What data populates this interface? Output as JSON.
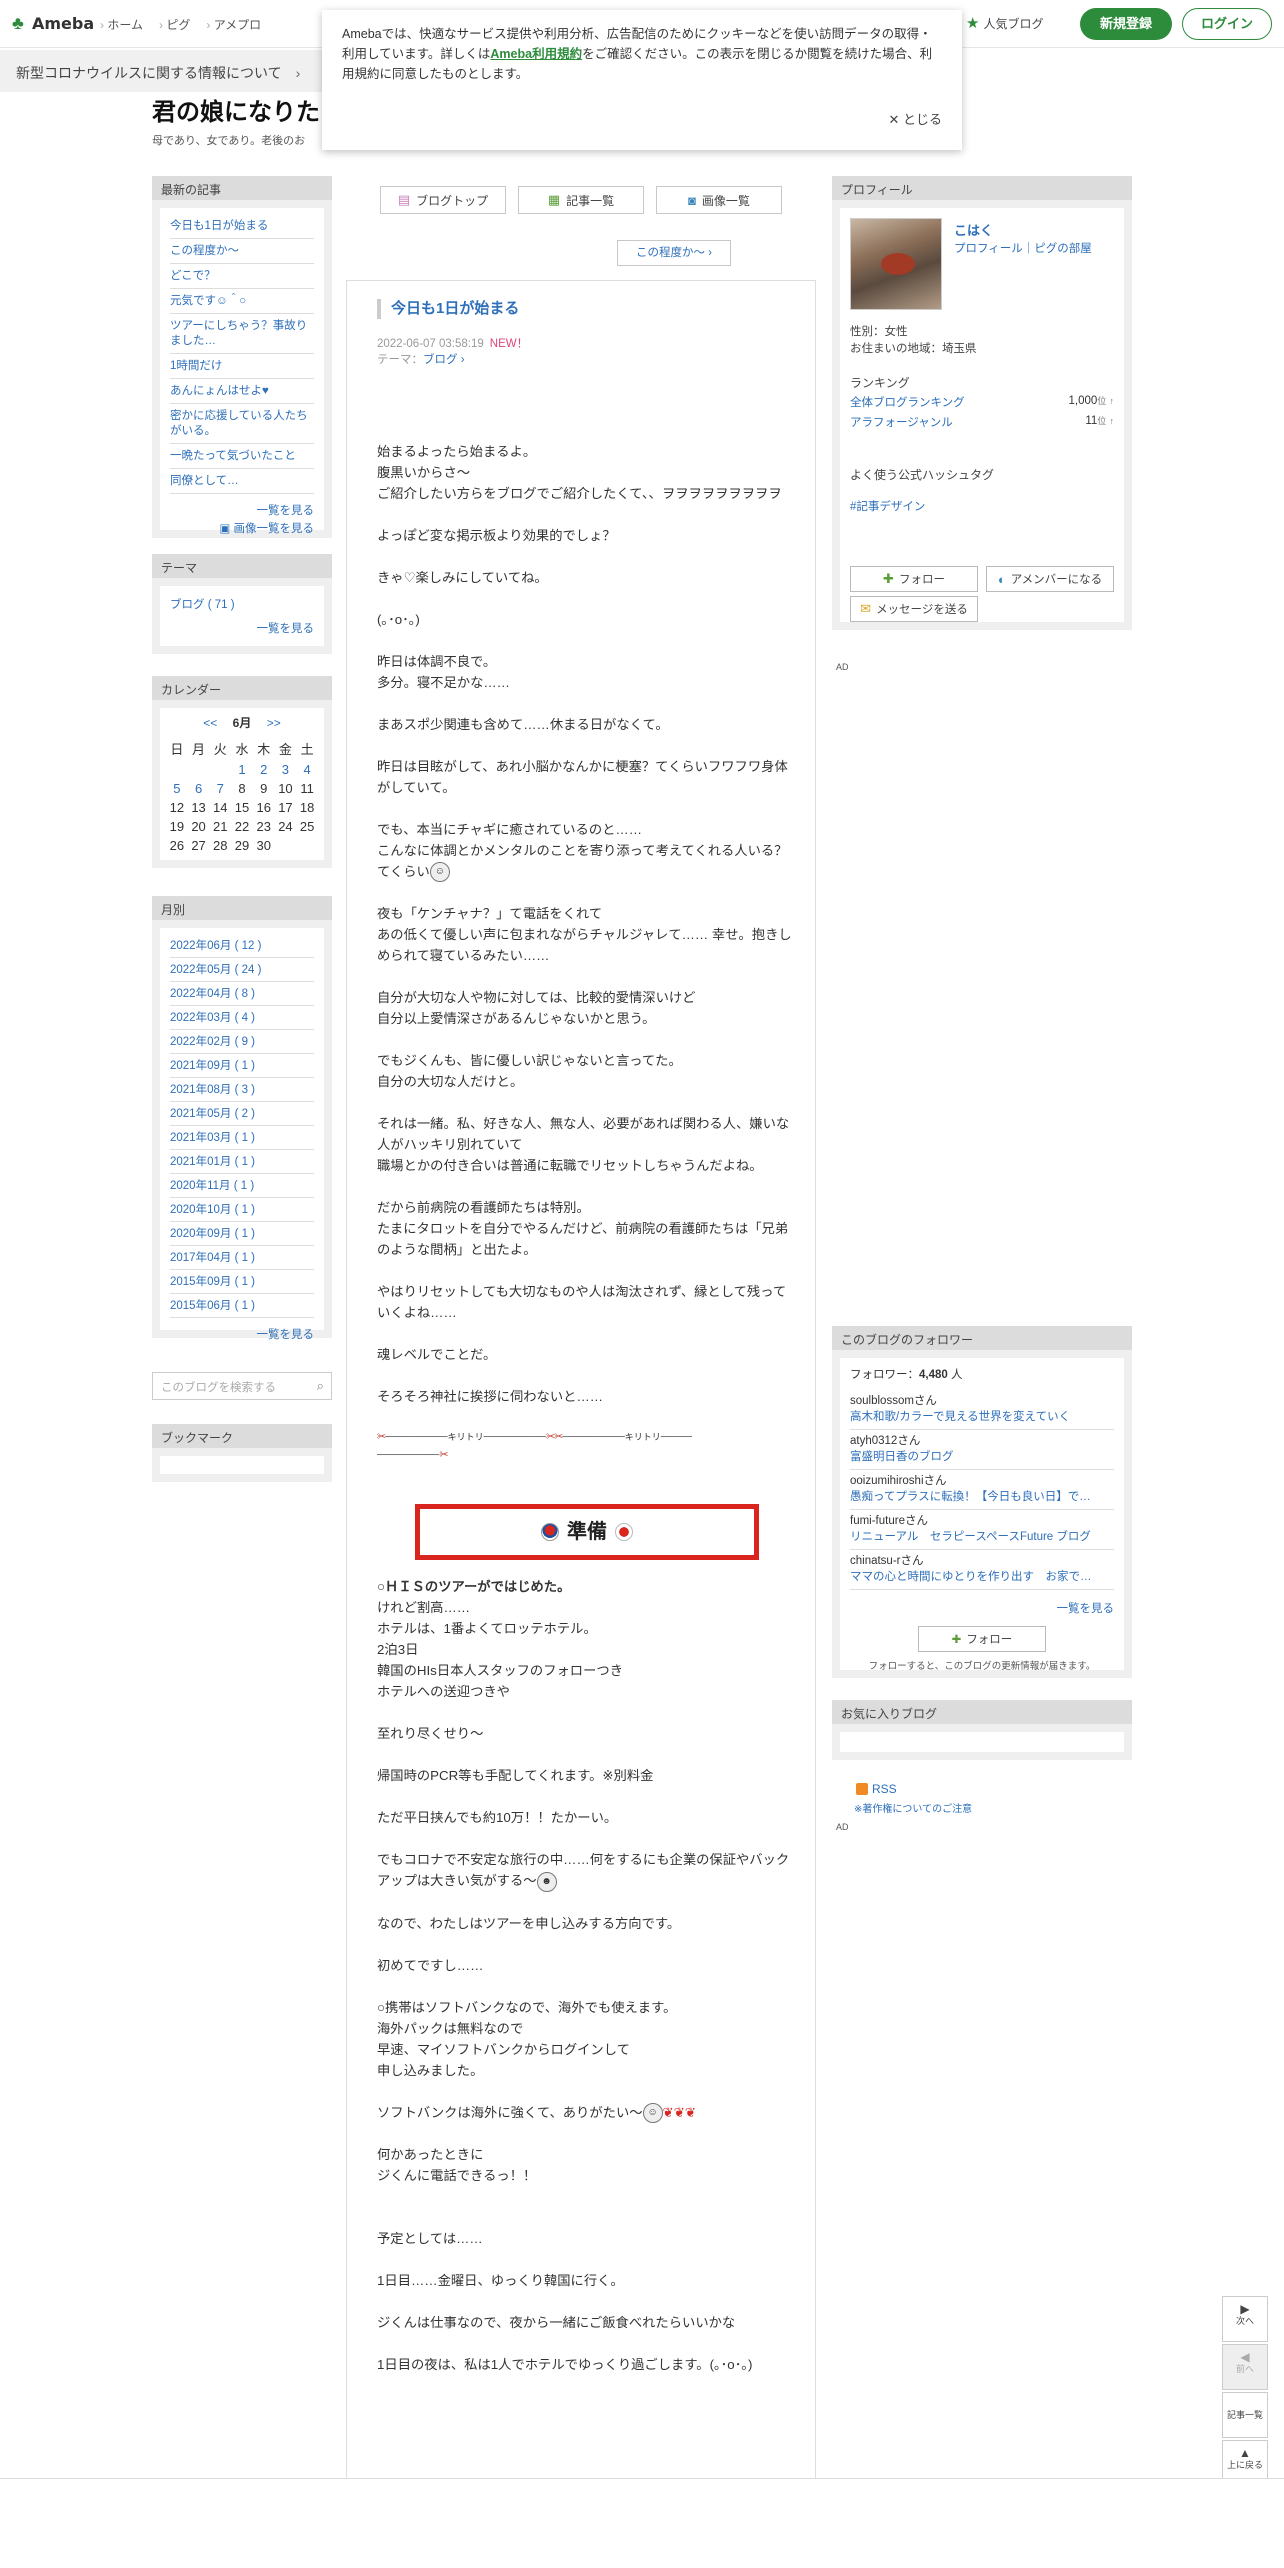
{
  "header": {
    "logo_text": "Ameba",
    "nav": [
      "ホーム",
      "ピグ",
      "アメプロ"
    ],
    "popular_blog": "人気ブログ",
    "signup": "新規登録",
    "login": "ログイン"
  },
  "covid_banner": "新型コロナウイルスに関する情報について",
  "cookie": {
    "text_before": "Amebaでは、快適なサービス提供や利用分析、広告配信のためにクッキーなどを使い訪問データの取得・利用しています。詳しくは",
    "terms_link": "Ameba利用規約",
    "text_after": "をご確認ください。この表示を閉じるか閲覧を続けた場合、利用規約に同意したものとします。",
    "close": "とじる"
  },
  "blog": {
    "title": "君の娘になりた",
    "description": "母であり、女であり。老後のお"
  },
  "sidebar": {
    "recent": {
      "title": "最新の記事",
      "items": [
        "今日も1日が始まる",
        "この程度か〜",
        "どこで？",
        "元気です☺︎＾○",
        "ツアーにしちゃう？事故りました…",
        "1時間だけ",
        "あんにょんはせよ♥",
        "密かに応援している人たちがいる。",
        "一晩たって気づいたこと",
        "同僚として…"
      ],
      "more": "一覧を見る",
      "image_more": "画像一覧を見る"
    },
    "theme": {
      "title": "テーマ",
      "item": "ブログ ( 71 )",
      "more": "一覧を見る"
    },
    "calendar": {
      "title": "カレンダー",
      "prev": "<<",
      "month": "6月",
      "next": ">>",
      "weekdays": [
        "日",
        "月",
        "火",
        "水",
        "木",
        "金",
        "土"
      ],
      "rows": [
        [
          "",
          "",
          "",
          "1",
          "2",
          "3",
          "4"
        ],
        [
          "5",
          "6",
          "7",
          "8",
          "9",
          "10",
          "11"
        ],
        [
          "12",
          "13",
          "14",
          "15",
          "16",
          "17",
          "18"
        ],
        [
          "19",
          "20",
          "21",
          "22",
          "23",
          "24",
          "25"
        ],
        [
          "26",
          "27",
          "28",
          "29",
          "30",
          "",
          ""
        ]
      ],
      "linked_days": [
        "1",
        "2",
        "3",
        "4",
        "5",
        "6",
        "7"
      ]
    },
    "archive": {
      "title": "月別",
      "items": [
        "2022年06月 ( 12 )",
        "2022年05月 ( 24 )",
        "2022年04月 ( 8 )",
        "2022年03月 ( 4 )",
        "2022年02月 ( 9 )",
        "2021年09月 ( 1 )",
        "2021年08月 ( 3 )",
        "2021年05月 ( 2 )",
        "2021年03月 ( 1 )",
        "2021年01月 ( 1 )",
        "2020年11月 ( 1 )",
        "2020年10月 ( 1 )",
        "2020年09月 ( 1 )",
        "2017年04月 ( 1 )",
        "2015年09月 ( 1 )",
        "2015年06月 ( 1 )"
      ],
      "more": "一覧を見る"
    },
    "search_placeholder": "このブログを検索する",
    "bookmark": "ブックマーク"
  },
  "topnav": {
    "blog_top": "ブログトップ",
    "articles": "記事一覧",
    "images": "画像一覧",
    "next_post": "この程度か〜"
  },
  "article": {
    "title": "今日も1日が始まる",
    "date": "2022-06-07 03:58:19",
    "new": "NEW！",
    "theme_label": "テーマ：",
    "theme": "ブログ",
    "p1": [
      "始まるよったら始まるよ。",
      "腹黒いからさ〜",
      "ご紹介したい方らをブログでご紹介したくて、、ヲヲヲヲヲヲヲヲヲ"
    ],
    "p2": "よっぽど変な掲示板より効果的でしょ？",
    "p3": "きゃ♡楽しみにしていてね。",
    "p4": "(｡･o･｡)",
    "p5": [
      "昨日は体調不良で。",
      "多分。寝不足かな……"
    ],
    "p6": "まあスポ少関連も含めて……休まる日がなくて。",
    "p7": [
      "昨日は目眩がして、あれ小脳かなんかに梗塞？てくらいフワフワ身体がしていて。"
    ],
    "p8": [
      "でも、本当にチャギに癒されているのと……",
      "こんなに体調とかメンタルのことを寄り添って考えてくれる人いる？",
      "てくらい"
    ],
    "p9": [
      "夜も「ケンチャナ？」て電話をくれて",
      "あの低くて優しい声に包まれながらチャルジャレて…… 幸せ。抱きしめられて寝ているみたい……"
    ],
    "p10": [
      "自分が大切な人や物に対しては、比較的愛情深いけど",
      "自分以上愛情深さがあるんじゃないかと思う。"
    ],
    "p11": [
      "でもジくんも、皆に優しい訳じゃないと言ってた。",
      "自分の大切な人だけと。"
    ],
    "p12": [
      "それは一緒。私、好きな人、無な人、必要があれば関わる人、嫌いな人がハッキリ別れていて",
      "職場とかの付き合いは普通に転職でリセットしちゃうんだよね。"
    ],
    "p13": [
      "だから前病院の看護師たちは特別。",
      "たまにタロットを自分でやるんだけど、前病院の看護師たちは「兄弟のような間柄」と出たよ。"
    ],
    "p14": "やはりリセットしても大切なものや人は淘汰されず、縁として残っていくよね……",
    "p15": "魂レベルでことだ。",
    "p16": "そろそろ神社に挨拶に伺わないと……",
    "cutline": "キリトリ",
    "banner": "準備",
    "p17": [
      "○ＨＩＳのツアーがではじめた。",
      "けれど割高……",
      "ホテルは、1番よくてロッテホテル。",
      "2泊3日",
      "韓国のHIs日本人スタッフのフォローつき",
      "ホテルへの送迎つきや"
    ],
    "p18": "至れり尽くせり〜",
    "p19": "帰国時のPCR等も手配してくれます。※別料金",
    "p20": "ただ平日挟んでも約10万！！たかーい。",
    "p21": "でもコロナで不安定な旅行の中……何をするにも企業の保証やバックアップは大きい気がする〜",
    "p22": "なので、わたしはツアーを申し込みする方向です。",
    "p23": "初めてですし……",
    "p24": [
      "○携帯はソフトバンクなので、海外でも使えます。",
      "海外パックは無料なので",
      "早速、マイソフトバンクからログインして",
      "申し込みました。"
    ],
    "p25": "ソフトバンクは海外に強くて、ありがたい〜",
    "p26": [
      "何かあったときに",
      "ジくんに電話できるっ！！"
    ],
    "p27": "予定としては……",
    "p28": "1日目……金曜日、ゆっくり韓国に行く。",
    "p29": "ジくんは仕事なので、夜から一緒にご飯食べれたらいいかな",
    "p30": "1日目の夜は、私は1人でホテルでゆっくり過ごします。(｡･o･｡)"
  },
  "profile": {
    "title": "プロフィール",
    "name": "こはく",
    "links": "プロフィール｜ピグの部屋",
    "gender": "性別：女性",
    "area": "お住まいの地域：埼玉県",
    "ranking_title": "ランキング",
    "rank1_label": "全体ブログランキング",
    "rank1_value": "1,000",
    "rank2_label": "アラフォージャンル",
    "rank2_value": "11",
    "rank_unit": "位",
    "hashtag_title": "よく使う公式ハッシュタグ",
    "hashtag": "#記事デザイン",
    "follow": "フォロー",
    "member": "アメンバーになる",
    "message": "メッセージを送る"
  },
  "ad_label": "AD",
  "followers": {
    "title": "このブログのフォロワー",
    "count_label": "フォロワー：",
    "count": "4,480",
    "count_unit": "人",
    "items": [
      {
        "user": "soulblossomさん",
        "blog": "高木和歌/カラーで見える世界を変えていく"
      },
      {
        "user": "atyh0312さん",
        "blog": "富盛明日香のブログ"
      },
      {
        "user": "ooizumihiroshiさん",
        "blog": "愚痴ってプラスに転換！【今日も良い日】で…"
      },
      {
        "user": "fumi-futureさん",
        "blog": "リニューアル　セラピースペースFuture ブログ"
      },
      {
        "user": "chinatsu-rさん",
        "blog": "ママの心と時間にゆとりを作り出す　お家で…"
      }
    ],
    "more": "一覧を見る",
    "follow": "フォロー",
    "note": "フォローすると、このブログの更新情報が届きます。"
  },
  "favorites_title": "お気に入りブログ",
  "rss": "RSS",
  "copyright_note": "※著作権についてのご注意",
  "floatnav": {
    "next": "次へ",
    "prev": "前へ",
    "list": "記事一覧",
    "top": "上に戻る"
  }
}
